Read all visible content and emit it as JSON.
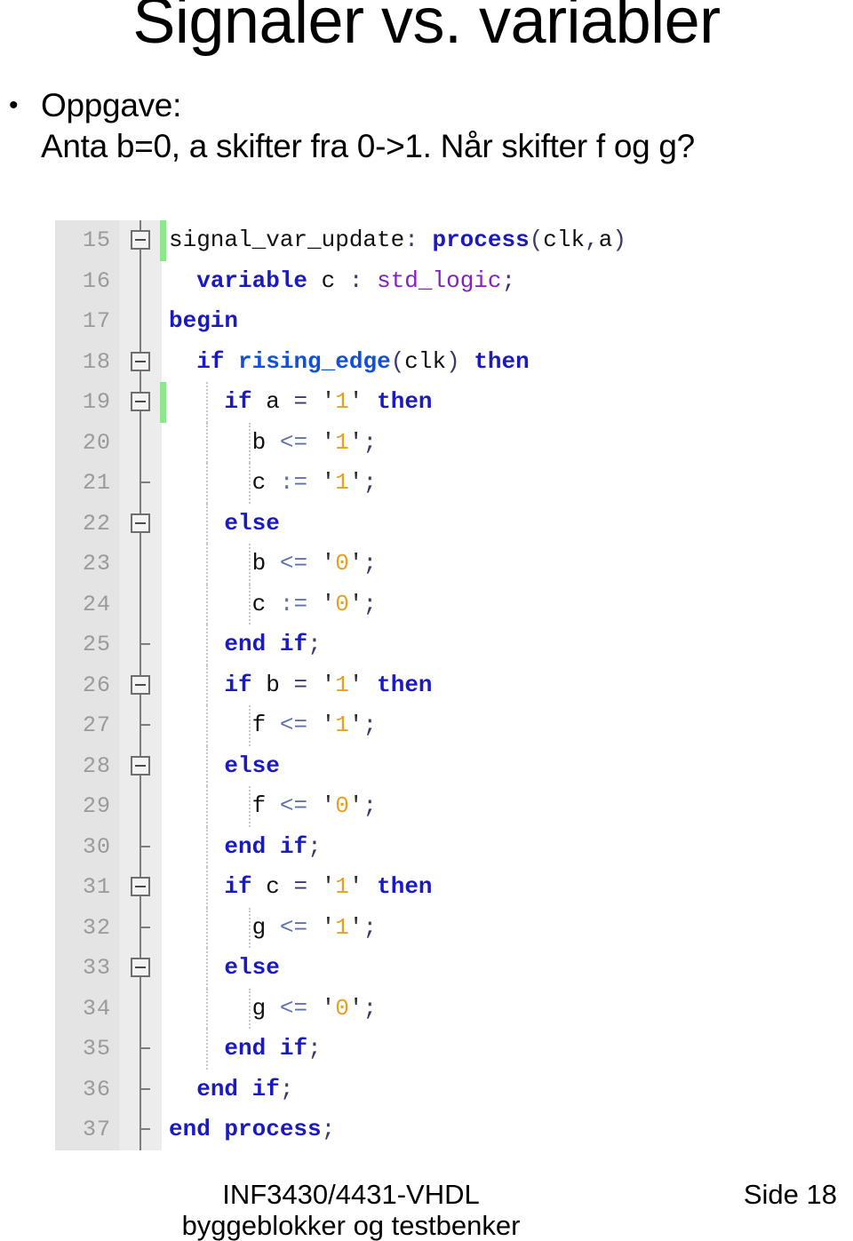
{
  "slide": {
    "title": "Signaler vs. variabler",
    "bullet_marker": "•",
    "bullet_lines": [
      "Oppgave:",
      "Anta b=0, a skifter fra 0->1.  Når skifter f og g?"
    ]
  },
  "footer": {
    "course_line1": "INF3430/4431-VHDL",
    "course_line2": "byggeblokker og testbenker",
    "page_label": "Side 18"
  },
  "code": {
    "language": "VHDL",
    "first_line_number": 15,
    "last_line_number": 37,
    "colors": {
      "keyword": "#1a1ac4",
      "function": "#1250d8",
      "type": "#8420c8",
      "operator": "#5f72a8",
      "literal": "#e8a020",
      "identifier": "#101010",
      "gutter_background": "#e4e4e4",
      "gutter_text": "#9a9a9a",
      "change_bar": "#8ce88c",
      "fold_line": "#7d7d7d",
      "indent_guide": "#c8c8c8",
      "editor_background": "#ffffff"
    },
    "lines": [
      {
        "n": "15",
        "fold": "box",
        "tick": false,
        "change": true,
        "guides": [],
        "text": "signal_var_update: process(clk,a)"
      },
      {
        "n": "16",
        "fold": "none",
        "tick": false,
        "change": false,
        "guides": [],
        "text": "  variable c : std_logic;"
      },
      {
        "n": "17",
        "fold": "none",
        "tick": false,
        "change": false,
        "guides": [],
        "text": "begin"
      },
      {
        "n": "18",
        "fold": "box",
        "tick": false,
        "change": false,
        "guides": [],
        "text": "  if rising_edge(clk) then"
      },
      {
        "n": "19",
        "fold": "box",
        "tick": false,
        "change": true,
        "guides": [
          1
        ],
        "text": "    if a = '1' then"
      },
      {
        "n": "20",
        "fold": "none",
        "tick": false,
        "change": false,
        "guides": [
          1,
          2
        ],
        "text": "      b <= '1';"
      },
      {
        "n": "21",
        "fold": "none",
        "tick": true,
        "change": false,
        "guides": [
          1,
          2
        ],
        "text": "      c := '1';"
      },
      {
        "n": "22",
        "fold": "box",
        "tick": false,
        "change": false,
        "guides": [
          1
        ],
        "text": "    else"
      },
      {
        "n": "23",
        "fold": "none",
        "tick": false,
        "change": false,
        "guides": [
          1,
          2
        ],
        "text": "      b <= '0';"
      },
      {
        "n": "24",
        "fold": "none",
        "tick": false,
        "change": false,
        "guides": [
          1,
          2
        ],
        "text": "      c := '0';"
      },
      {
        "n": "25",
        "fold": "none",
        "tick": true,
        "change": false,
        "guides": [
          1
        ],
        "text": "    end if;"
      },
      {
        "n": "26",
        "fold": "box",
        "tick": false,
        "change": false,
        "guides": [
          1
        ],
        "text": "    if b = '1' then"
      },
      {
        "n": "27",
        "fold": "none",
        "tick": true,
        "change": false,
        "guides": [
          1,
          2
        ],
        "text": "      f <= '1';"
      },
      {
        "n": "28",
        "fold": "box",
        "tick": false,
        "change": false,
        "guides": [
          1
        ],
        "text": "    else"
      },
      {
        "n": "29",
        "fold": "none",
        "tick": false,
        "change": false,
        "guides": [
          1,
          2
        ],
        "text": "      f <= '0';"
      },
      {
        "n": "30",
        "fold": "none",
        "tick": true,
        "change": false,
        "guides": [
          1
        ],
        "text": "    end if;"
      },
      {
        "n": "31",
        "fold": "box",
        "tick": false,
        "change": false,
        "guides": [
          1
        ],
        "text": "    if c = '1' then"
      },
      {
        "n": "32",
        "fold": "none",
        "tick": true,
        "change": false,
        "guides": [
          1,
          2
        ],
        "text": "      g <= '1';"
      },
      {
        "n": "33",
        "fold": "box",
        "tick": false,
        "change": false,
        "guides": [
          1
        ],
        "text": "    else"
      },
      {
        "n": "34",
        "fold": "none",
        "tick": false,
        "change": false,
        "guides": [
          1,
          2
        ],
        "text": "      g <= '0';"
      },
      {
        "n": "35",
        "fold": "none",
        "tick": true,
        "change": false,
        "guides": [
          1
        ],
        "text": "    end if;"
      },
      {
        "n": "36",
        "fold": "none",
        "tick": true,
        "change": false,
        "guides": [],
        "text": "  end if;"
      },
      {
        "n": "37",
        "fold": "none",
        "tick": true,
        "change": false,
        "guides": [],
        "text": "end process;"
      }
    ]
  }
}
